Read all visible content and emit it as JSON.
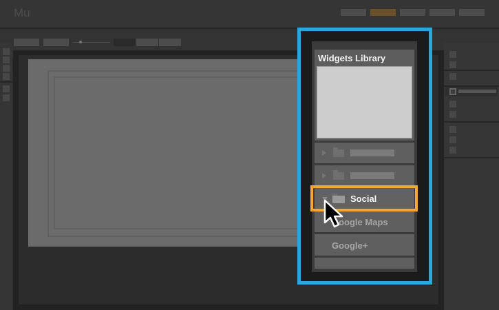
{
  "app": {
    "logo": "Mu"
  },
  "widgets_panel": {
    "title": "Widgets Library",
    "folders": [
      {
        "label": ""
      },
      {
        "label": ""
      },
      {
        "label": "Social",
        "expanded": true
      }
    ],
    "items": [
      {
        "label": "Google Maps"
      },
      {
        "label": "Google+"
      }
    ]
  },
  "colors": {
    "callout": "#29a8e0",
    "highlight": "#f3a833",
    "accent_button": "#6b4f28"
  }
}
